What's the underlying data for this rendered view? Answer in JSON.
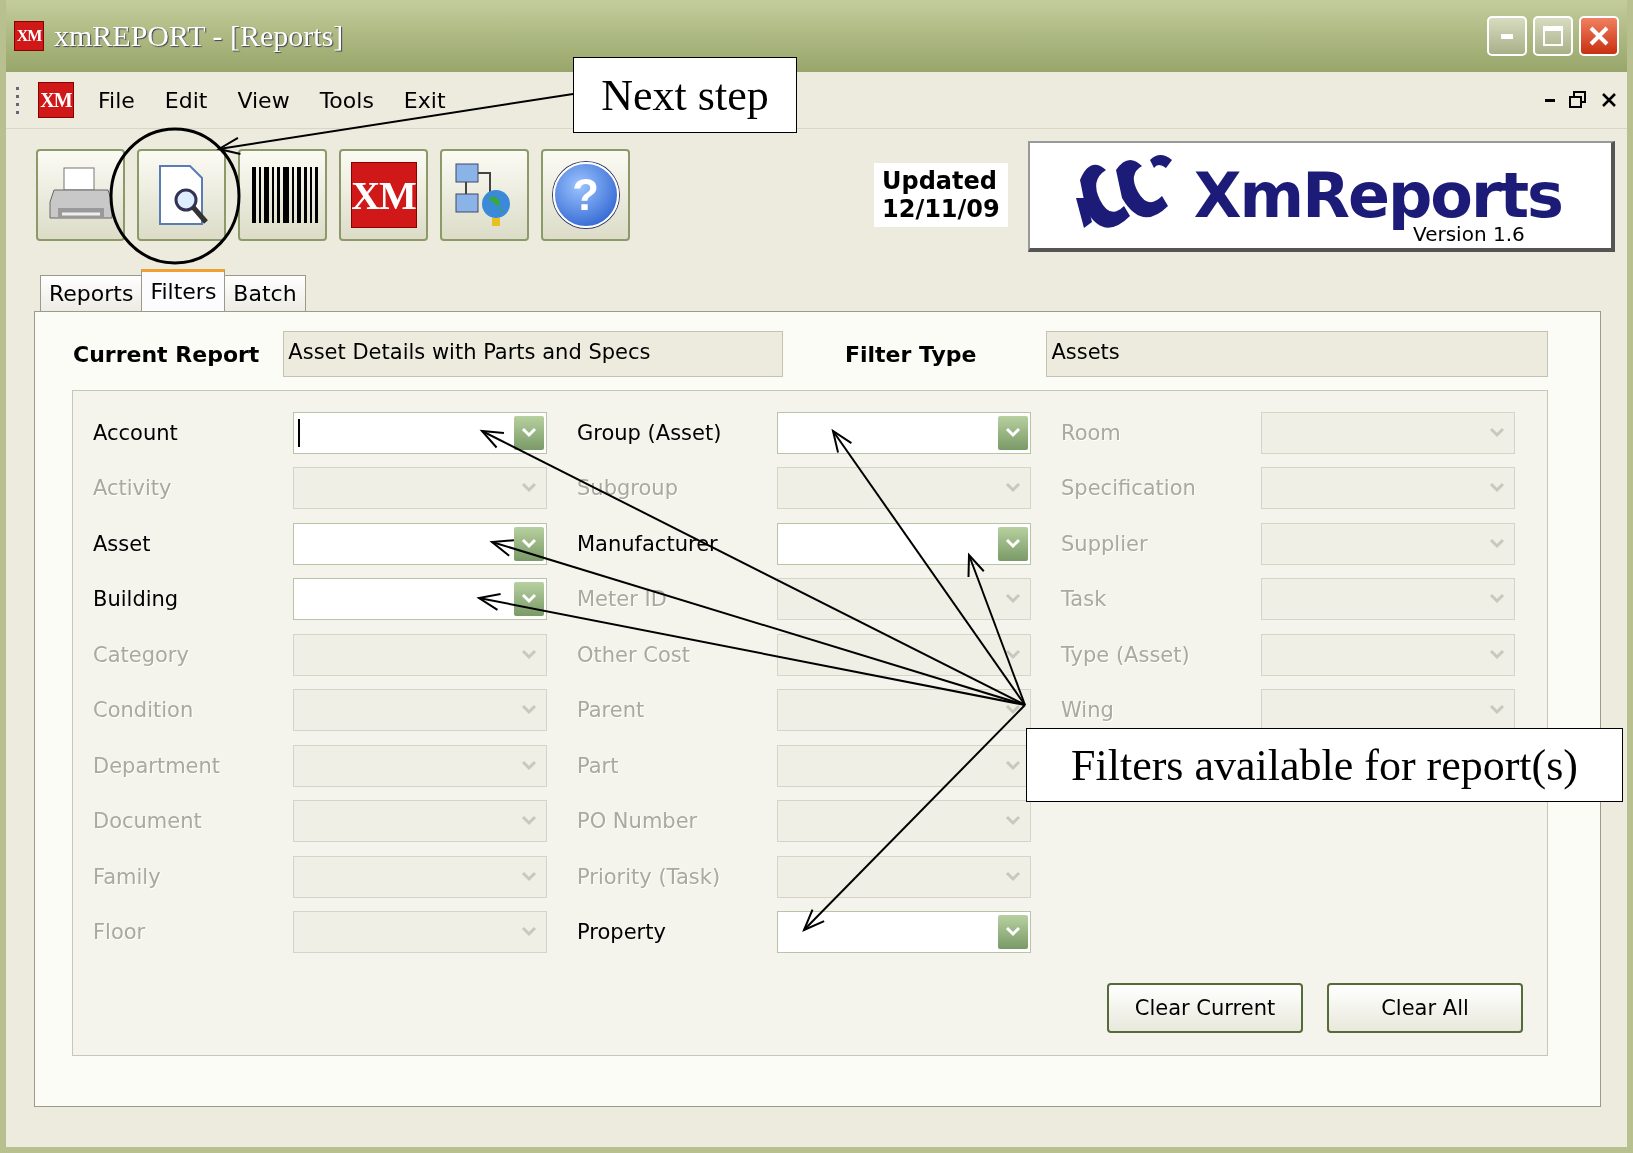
{
  "window": {
    "icon_text": "XM",
    "title": "xmREPORT - [Reports]"
  },
  "menu": {
    "icon_text": "XM",
    "items": [
      "File",
      "Edit",
      "View",
      "Tools",
      "Exit"
    ]
  },
  "toolbar": [
    {
      "kind": "printer"
    },
    {
      "kind": "preview"
    },
    {
      "kind": "barcode"
    },
    {
      "kind": "xm",
      "text": "XM"
    },
    {
      "kind": "network"
    },
    {
      "kind": "help",
      "text": "?"
    }
  ],
  "updated": {
    "label": "Updated",
    "date": "12/11/09"
  },
  "logo": {
    "name": "XmReports",
    "version": "Version 1.6"
  },
  "tabs": [
    {
      "label": "Reports",
      "selected": false
    },
    {
      "label": "Filters",
      "selected": true
    },
    {
      "label": "Batch",
      "selected": false
    }
  ],
  "current_report": {
    "label": "Current Report",
    "value": "Asset Details with Parts and Specs"
  },
  "filter_type": {
    "label": "Filter Type",
    "value": "Assets"
  },
  "filter_columns": [
    [
      {
        "label": "Account",
        "disabled": false,
        "focused": true
      },
      {
        "label": "Activity",
        "disabled": true,
        "focused": false
      },
      {
        "label": "Asset",
        "disabled": false,
        "focused": false
      },
      {
        "label": "Building",
        "disabled": false,
        "focused": false
      },
      {
        "label": "Category",
        "disabled": true,
        "focused": false
      },
      {
        "label": "Condition",
        "disabled": true,
        "focused": false
      },
      {
        "label": "Department",
        "disabled": true,
        "focused": false
      },
      {
        "label": "Document",
        "disabled": true,
        "focused": false
      },
      {
        "label": "Family",
        "disabled": true,
        "focused": false
      },
      {
        "label": "Floor",
        "disabled": true,
        "focused": false
      }
    ],
    [
      {
        "label": "Group (Asset)",
        "disabled": false,
        "focused": false
      },
      {
        "label": "Subgroup",
        "disabled": true,
        "focused": false
      },
      {
        "label": "Manufacturer",
        "disabled": false,
        "focused": false
      },
      {
        "label": "Meter ID",
        "disabled": true,
        "focused": false
      },
      {
        "label": "Other Cost",
        "disabled": true,
        "focused": false
      },
      {
        "label": "Parent",
        "disabled": true,
        "focused": false
      },
      {
        "label": "Part",
        "disabled": true,
        "focused": false
      },
      {
        "label": "PO Number",
        "disabled": true,
        "focused": false
      },
      {
        "label": "Priority (Task)",
        "disabled": true,
        "focused": false
      },
      {
        "label": "Property",
        "disabled": false,
        "focused": false
      }
    ],
    [
      {
        "label": "Room",
        "disabled": true,
        "focused": false
      },
      {
        "label": "Specification",
        "disabled": true,
        "focused": false
      },
      {
        "label": "Supplier",
        "disabled": true,
        "focused": false
      },
      {
        "label": "Task",
        "disabled": true,
        "focused": false
      },
      {
        "label": "Type (Asset)",
        "disabled": true,
        "focused": false
      },
      {
        "label": "Wing",
        "disabled": true,
        "focused": false
      }
    ]
  ],
  "buttons": [
    "Clear Current",
    "Clear All"
  ],
  "annotations": [
    {
      "kind": "next",
      "text": "Next step"
    },
    {
      "kind": "filters",
      "text": "Filters available for report(s)"
    }
  ]
}
